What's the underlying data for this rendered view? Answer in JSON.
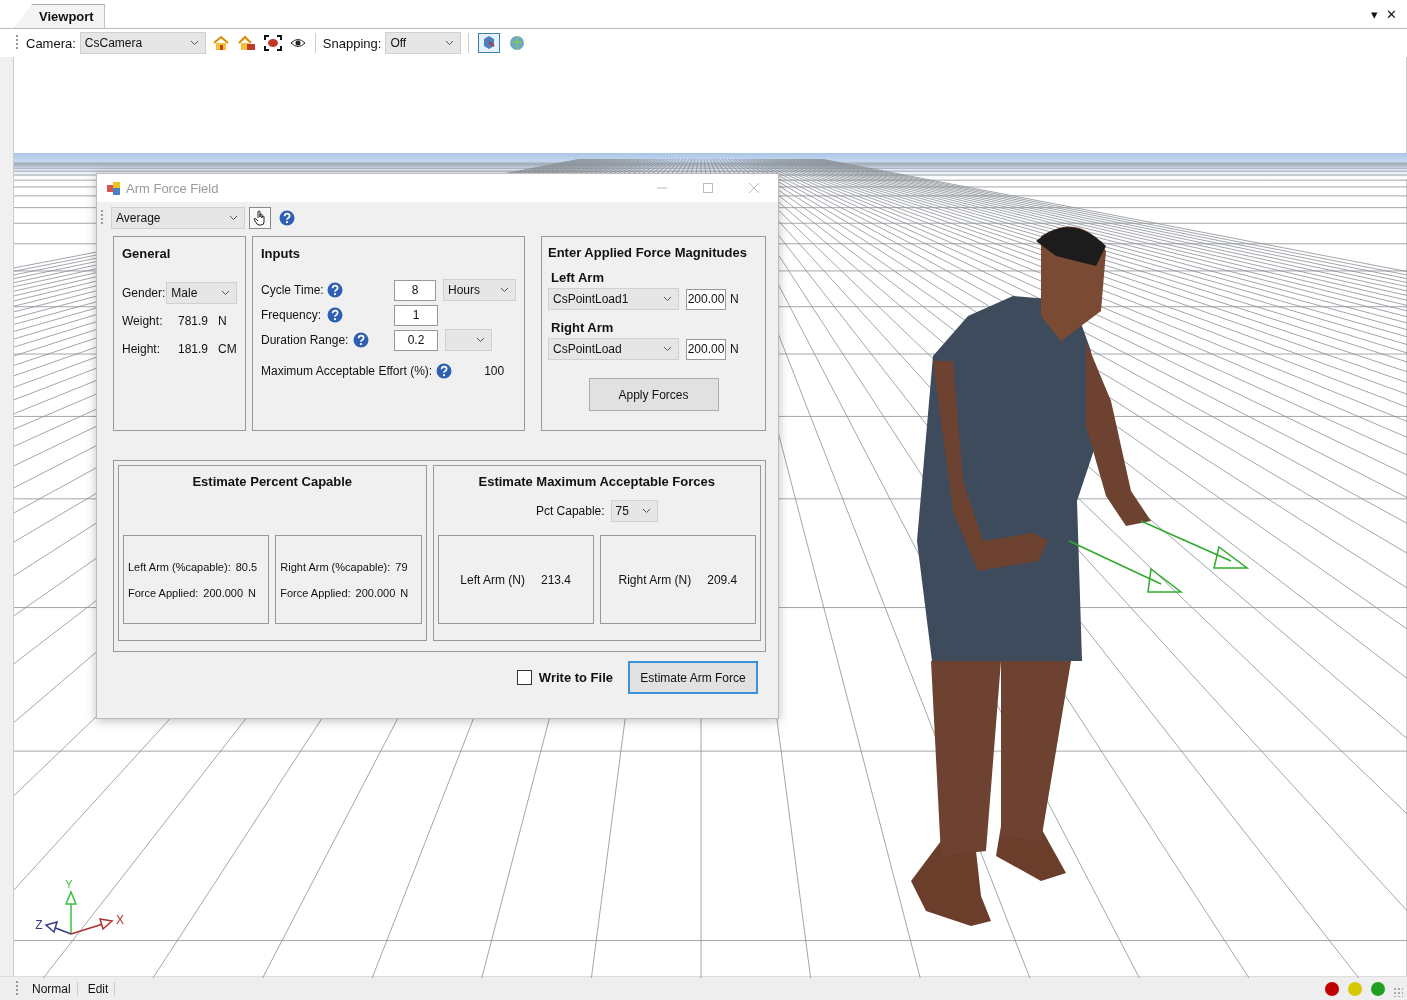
{
  "viewport_tab": {
    "label": "Viewport"
  },
  "pane_controls": [
    "▾",
    "✕"
  ],
  "toolbar": {
    "camera_label": "Camera:",
    "camera_value": "CsCamera",
    "snapping_label": "Snapping:",
    "snapping_value": "Off"
  },
  "dialog": {
    "title": "Arm Force Field",
    "preset": "Average",
    "general": {
      "title": "General",
      "gender_label": "Gender:",
      "gender": "Male",
      "rows": [
        {
          "label": "Weight:",
          "value": "781.9",
          "unit": "N"
        },
        {
          "label": "Height:",
          "value": "181.9",
          "unit": "CM"
        }
      ]
    },
    "inputs": {
      "title": "Inputs",
      "rows": [
        {
          "kind": "field_select",
          "label": "Cycle Time:",
          "value": "8",
          "unit": "Hours"
        },
        {
          "kind": "field",
          "label": "Frequency:",
          "value": "1"
        },
        {
          "kind": "field_empty_select",
          "label": "Duration Range:",
          "value": "0.2"
        },
        {
          "kind": "readout",
          "label": "Maximum Acceptable Effort (%):",
          "value": "100"
        }
      ]
    },
    "forces": {
      "title": "Enter Applied Force Magnitudes",
      "arms": [
        {
          "label": "Left Arm",
          "load": "CsPointLoad1",
          "value": "200.00",
          "unit": "N"
        },
        {
          "label": "Right Arm",
          "load": "CsPointLoad",
          "value": "200.00",
          "unit": "N"
        }
      ],
      "apply_button": "Apply Forces"
    },
    "percent_capable": {
      "title": "Estimate Percent Capable",
      "arms": [
        {
          "label": "Left Arm (%capable):",
          "value": "80.5",
          "force_label": "Force Applied:",
          "force": "200.000",
          "unit": "N"
        },
        {
          "label": "Right Arm (%capable):",
          "value": "79",
          "force_label": "Force Applied:",
          "force": "200.000",
          "unit": "N"
        }
      ]
    },
    "max_forces": {
      "title": "Estimate Maximum Acceptable Forces",
      "pct_label": "Pct Capable:",
      "pct": "75",
      "arms": [
        {
          "label": "Left Arm (N)",
          "value": "213.4"
        },
        {
          "label": "Right Arm (N)",
          "value": "209.4"
        }
      ]
    },
    "write_to_file": {
      "label": "Write to File",
      "checked": false
    },
    "estimate_button": "Estimate Arm Force"
  },
  "axes": [
    {
      "label": "Y"
    },
    {
      "label": "Z"
    },
    {
      "label": "X"
    }
  ],
  "status_bar": {
    "items": [
      "Normal",
      "Edit"
    ],
    "lights": [
      {
        "color": "#c00000"
      },
      {
        "color": "#d4c800"
      },
      {
        "color": "#1fa01f"
      }
    ]
  }
}
